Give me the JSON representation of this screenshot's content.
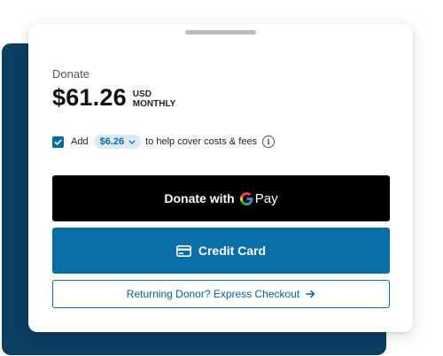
{
  "donation": {
    "label": "Donate",
    "amount": "$61.26",
    "currency": "USD",
    "frequency": "MONTHLY"
  },
  "fees": {
    "checked": true,
    "prefix": "Add",
    "fee_amount": "$6.26",
    "suffix": "to help cover costs & fees",
    "info_glyph": "i"
  },
  "buttons": {
    "gpay_label": "Donate with",
    "gpay_g": "G",
    "gpay_pay": "Pay",
    "credit_card_label": "Credit Card",
    "express_label": "Returning Donor? Express Checkout"
  },
  "colors": {
    "backdrop": "#0b3e63",
    "primary": "#0a6ea8",
    "gpay_bg": "#000000",
    "pill_bg": "#dceaf5"
  },
  "icons": [
    "chevron-down-icon",
    "info-icon",
    "google-g-icon",
    "credit-card-icon",
    "arrow-right-icon",
    "checkmark-icon"
  ]
}
